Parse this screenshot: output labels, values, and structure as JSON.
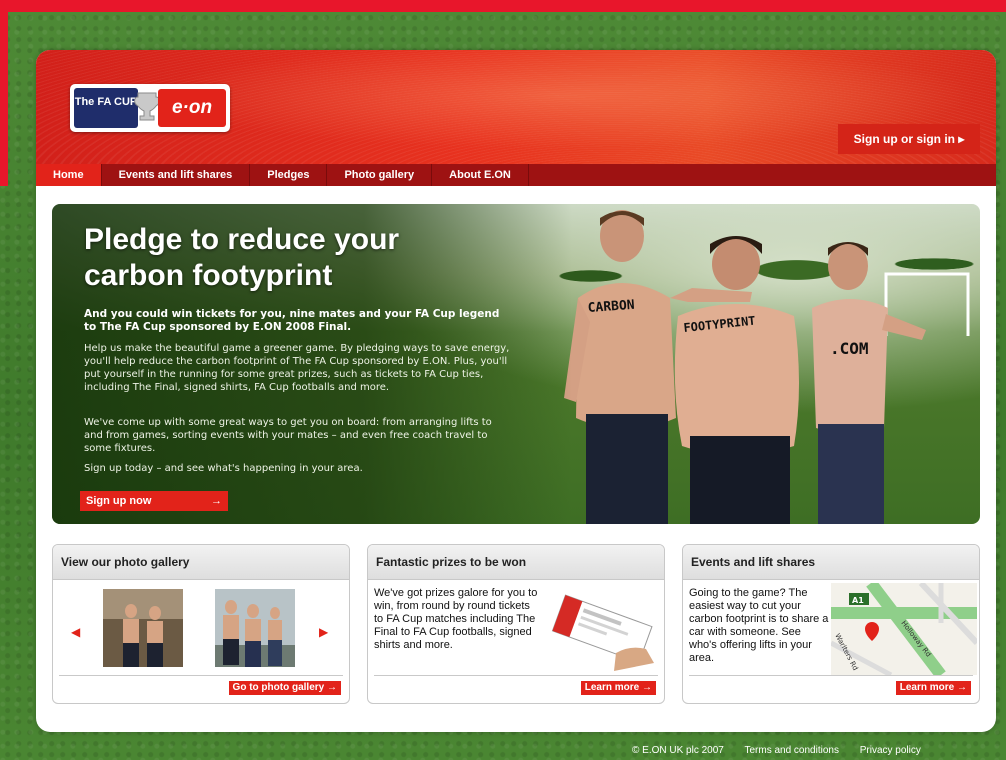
{
  "header": {
    "logo_fa_text": "The FA CUP",
    "logo_eon_text": "e·on",
    "signin_label": "Sign up or sign in ▸"
  },
  "nav": {
    "items": [
      {
        "label": "Home",
        "active": true
      },
      {
        "label": "Events and lift shares"
      },
      {
        "label": "Pledges"
      },
      {
        "label": "Photo gallery"
      },
      {
        "label": "About E.ON"
      }
    ]
  },
  "hero": {
    "title": "Pledge to reduce your carbon footyprint",
    "lead": "And you could win tickets for you, nine mates and your FA Cup legend to The FA Cup sponsored by E.ON 2008 Final.",
    "p1": "Help us make the beautiful game a greener game. By pledging ways to save energy, you'll help reduce the carbon footprint of The FA Cup sponsored by E.ON. Plus, you'll put yourself in the running for some great prizes, such as tickets to FA Cup ties, including The Final, signed shirts, FA Cup footballs and more.",
    "p2": "We've come up with some great ways to get you on board: from arranging lifts to and from games, sorting events with your mates – and even free coach travel to some fixtures.",
    "p3": "Sign up today – and see what's happening in your area.",
    "button_label": "Sign up now",
    "body_words": [
      "CARBON",
      "FOOTYPRINT",
      ".COM"
    ]
  },
  "boxes": {
    "gallery": {
      "title": "View our photo gallery",
      "button_label": "Go to photo gallery →"
    },
    "prizes": {
      "title": "Fantastic prizes to be won",
      "text": "We've got prizes galore for you to win, from round by round tickets to FA Cup matches including The Final to FA Cup footballs, signed shirts and more.",
      "button_label": "Learn more →"
    },
    "events": {
      "title": "Events and lift shares",
      "text": "Going to the game? The easiest way to cut your carbon footprint is to share a car with someone. See who's offering lifts in your area.",
      "button_label": "Learn more →",
      "map_labels": [
        "A1",
        "Holloway Rd",
        "Warlters Rd"
      ]
    }
  },
  "footer": {
    "copyright": "© E.ON UK plc 2007",
    "terms": "Terms and conditions",
    "privacy": "Privacy policy"
  },
  "colors": {
    "brand_red": "#e2231a",
    "nav_dark_red": "#9e1212",
    "fa_navy": "#1f2d6b"
  }
}
